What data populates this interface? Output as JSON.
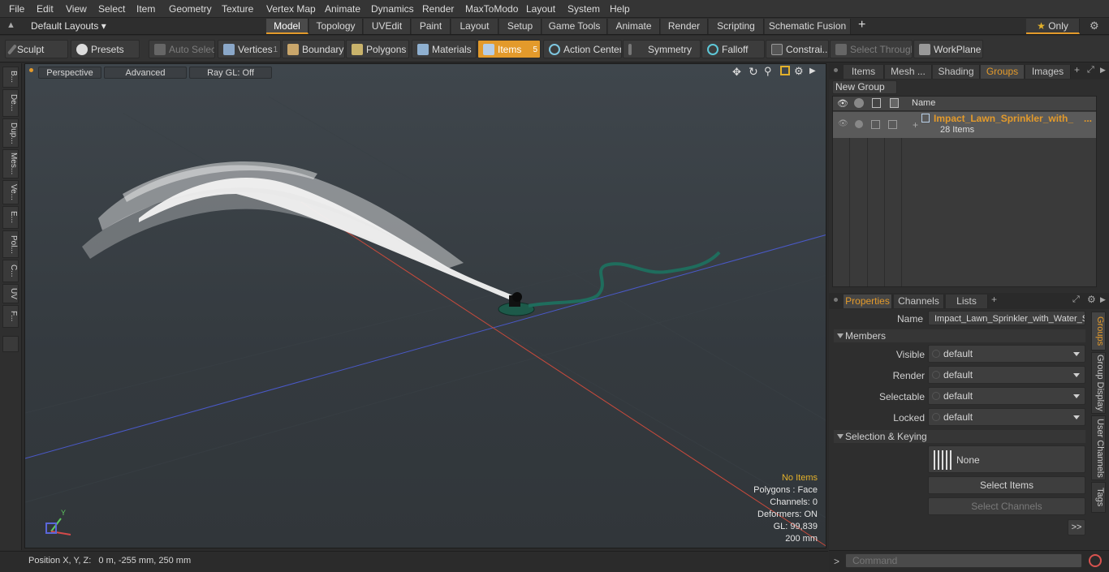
{
  "menu": [
    "File",
    "Edit",
    "View",
    "Select",
    "Item",
    "Geometry",
    "Texture",
    "Vertex Map",
    "Animate",
    "Dynamics",
    "Render",
    "MaxToModo",
    "Layout",
    "System",
    "Help"
  ],
  "layout_selector": "Default Layouts",
  "mode_tabs": [
    "Model",
    "Topology",
    "UVEdit",
    "Paint",
    "Layout",
    "Setup",
    "Game Tools",
    "Animate",
    "Render",
    "Scripting",
    "Schematic Fusion"
  ],
  "active_mode": "Model",
  "only_label": "Only",
  "toolbar": {
    "sculpt": "Sculpt",
    "presets": "Presets",
    "auto_select": "Auto Select",
    "vertices": "Vertices",
    "vertices_count": "1",
    "boundary": "Boundary",
    "polygons": "Polygons",
    "materials": "Materials",
    "items": "Items",
    "items_count": "5",
    "action_center": "Action Center",
    "symmetry": "Symmetry",
    "falloff": "Falloff",
    "constraints": "Constrai...",
    "select_through": "Select Through",
    "workplane": "WorkPlane"
  },
  "left_tabs": [
    "B...",
    "De...",
    "Dup...",
    "Mes...",
    "Ve...",
    "E...",
    "Pol...",
    "C...",
    "UV",
    "F..."
  ],
  "viewport": {
    "view": "Perspective",
    "shading": "Advanced",
    "raygl": "Ray GL: Off",
    "info": {
      "selection": "No Items",
      "polygons": "Polygons : Face",
      "channels": "Channels: 0",
      "deformers": "Deformers: ON",
      "gl": "GL: 99,839",
      "scale": "200 mm"
    }
  },
  "status": {
    "position": "Position X, Y, Z:   0 m, -255 mm, 250 mm"
  },
  "outliner": {
    "tabs": [
      "Items",
      "Mesh ...",
      "Shading",
      "Groups",
      "Images"
    ],
    "active_tab": "Groups",
    "new_group": "New Group",
    "column_name": "Name",
    "group_name": "Impact_Lawn_Sprinkler_with_",
    "group_more": "...",
    "group_count": "28 Items"
  },
  "properties": {
    "tabs": [
      "Properties",
      "Channels",
      "Lists"
    ],
    "active_tab": "Properties",
    "name_label": "Name",
    "name_value": "Impact_Lawn_Sprinkler_with_Water_S",
    "members_section": "Members",
    "visible_label": "Visible",
    "visible_value": "default",
    "render_label": "Render",
    "render_value": "default",
    "selectable_label": "Selectable",
    "selectable_value": "default",
    "locked_label": "Locked",
    "locked_value": "default",
    "keying_section": "Selection & Keying",
    "none_label": "None",
    "select_items": "Select Items",
    "select_channels": "Select Channels",
    "more": ">>",
    "side_tabs": [
      "Groups",
      "Group Display",
      "User Channels",
      "Tags"
    ]
  },
  "command": {
    "placeholder": "Command",
    "prompt": ">"
  }
}
